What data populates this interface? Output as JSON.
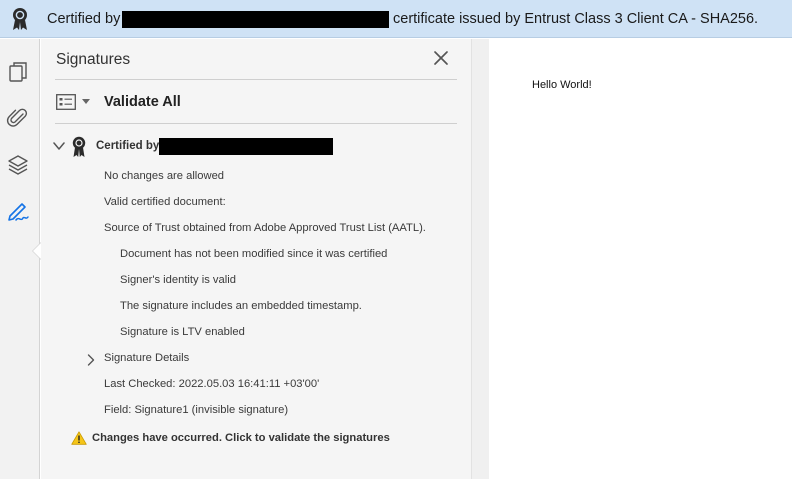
{
  "banner": {
    "prefix": "Certified by",
    "suffix": "certificate issued by Entrust Class 3 Client CA - SHA256.",
    "badge_icon": "ribbon-badge-icon"
  },
  "toolrail": {
    "tools": [
      {
        "name": "page-thumbnails-icon"
      },
      {
        "name": "attachments-icon"
      },
      {
        "name": "layers-icon"
      },
      {
        "name": "signatures-icon",
        "active": true
      }
    ]
  },
  "panel": {
    "title": "Signatures",
    "close_icon": "close-icon",
    "validate_all": "Validate All",
    "certified_by": "Certified by",
    "lines": {
      "no_changes": "No changes are allowed",
      "valid_cert": "Valid certified document:",
      "source_trust": "Source of Trust obtained from Adobe Approved Trust List (AATL).",
      "not_modified": "Document has not been modified since it was certified",
      "identity_valid": "Signer's identity is valid",
      "timestamp": "The signature includes an embedded timestamp.",
      "ltv": "Signature is LTV enabled",
      "details": "Signature Details",
      "last_checked": "Last Checked: 2022.05.03 16:41:11 +03'00'",
      "field": "Field: Signature1 (invisible signature)"
    },
    "warning": "Changes have occurred. Click to validate the signatures"
  },
  "document": {
    "text": "Hello World!"
  },
  "colors": {
    "banner_bg": "#cfe2f5",
    "accent_blue": "#1473e6",
    "warning_yellow": "#f5c518"
  }
}
